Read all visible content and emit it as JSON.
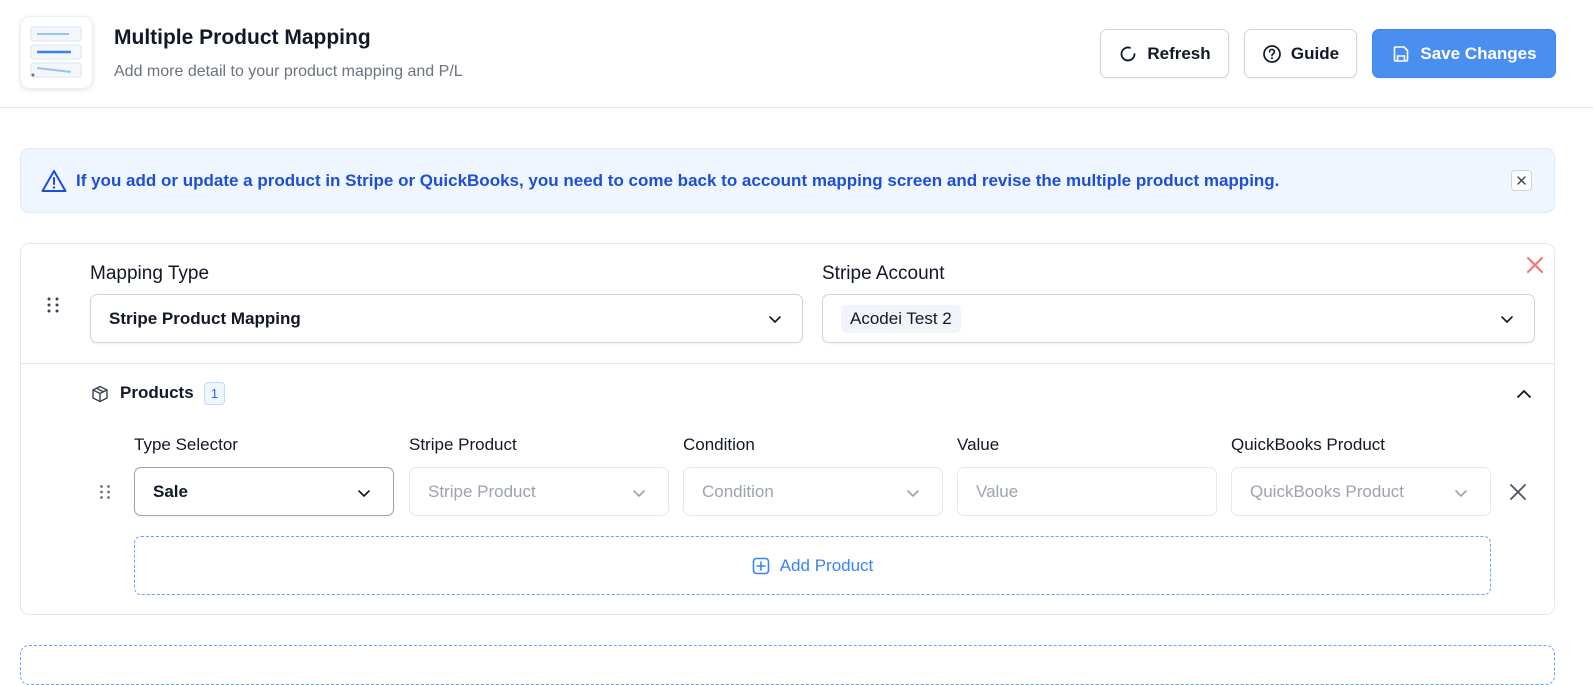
{
  "header": {
    "title": "Multiple Product Mapping",
    "subtitle": "Add more detail to your product mapping and P/L",
    "refresh_label": "Refresh",
    "guide_label": "Guide",
    "save_label": "Save Changes"
  },
  "alert": {
    "message": "If you add or update a product in Stripe or QuickBooks, you need to come back to account mapping screen and revise the multiple product mapping."
  },
  "mapping": {
    "mapping_type_label": "Mapping Type",
    "mapping_type_value": "Stripe Product Mapping",
    "stripe_account_label": "Stripe Account",
    "stripe_account_value": "Acodei Test 2",
    "products_label": "Products",
    "products_count": "1",
    "columns": {
      "type_selector": "Type Selector",
      "stripe_product": "Stripe Product",
      "condition": "Condition",
      "value": "Value",
      "quickbooks_product": "QuickBooks Product"
    },
    "row": {
      "type_selector_value": "Sale",
      "stripe_product_placeholder": "Stripe Product",
      "condition_placeholder": "Condition",
      "value_placeholder": "Value",
      "quickbooks_product_placeholder": "QuickBooks Product"
    },
    "add_product_label": "Add Product"
  },
  "colors": {
    "primary": "#4a8ff0",
    "alert_text": "#1d4ed8",
    "alert_bg": "#eff6ff",
    "remove": "#f87171"
  }
}
